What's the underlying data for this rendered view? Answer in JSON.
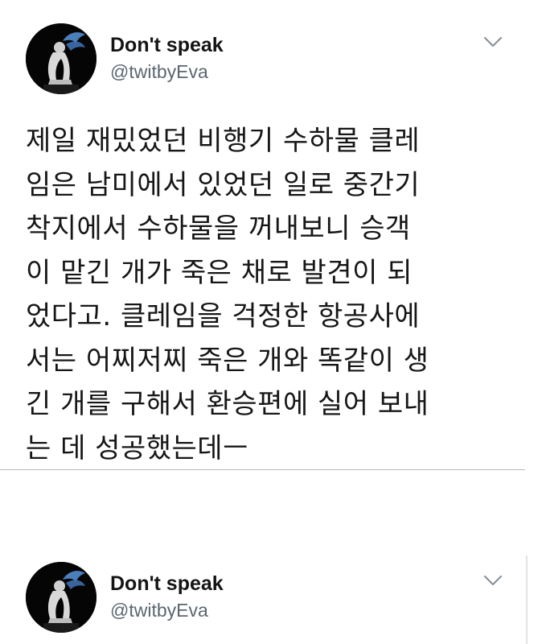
{
  "tweets": [
    {
      "author": {
        "display_name": "Don't speak",
        "handle": "@twitbyEva",
        "avatar_icon": "profile-photo"
      },
      "menu_icon": "chevron-down-icon",
      "text_lines": [
        "제일 재밌었던 비행기 수하물 클레",
        "임은 남미에서 있었던 일로 중간기",
        "착지에서 수하물을 꺼내보니 승객",
        "이 맡긴 개가 죽은 채로 발견이 되",
        "었다고. 클레임을 걱정한 항공사에",
        "서는 어찌저찌 죽은 개와 똑같이 생",
        "긴 개를 구해서 환승편에 실어 보내",
        "는 데 성공했는데ㅡ"
      ]
    },
    {
      "author": {
        "display_name": "Don't speak",
        "handle": "@twitbyEva",
        "avatar_icon": "profile-photo"
      },
      "menu_icon": "chevron-down-icon"
    }
  ],
  "colors": {
    "background": "#ffffff",
    "text": "#161616",
    "handle": "#5b6670",
    "divider": "#b9b9b9",
    "avatar_bg": "#050505",
    "avatar_accent": "#4f86c6"
  }
}
